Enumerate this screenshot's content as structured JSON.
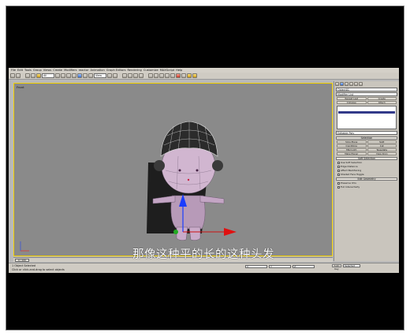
{
  "menu": [
    "File",
    "Edit",
    "Tools",
    "Group",
    "Views",
    "Create",
    "Modifiers",
    "reactor",
    "Animation",
    "Graph Editors",
    "Rendering",
    "Customize",
    "MAXScript",
    "Help"
  ],
  "toolbar": {
    "selection_filter": "All",
    "view_dropdown": "View"
  },
  "viewport": {
    "label": "Front"
  },
  "command_panel": {
    "object_name": "Object01",
    "modifier_list": "Modifier List",
    "stack_item": "Editable Poly",
    "rollout_selection": "Selection",
    "rollout_soft": "Soft Selection",
    "rollout_edit": "Edit Geometry",
    "button_labels": [
      "Repeat Last",
      "Create",
      "Collapse",
      "Attach",
      "Slice Plane",
      "Split",
      "QuickSlice",
      "Cut",
      "MSmooth",
      "Tessellate",
      "Make Planar",
      "View Align"
    ],
    "checks": [
      "Use Soft Selection",
      "Edge Distance",
      "Affect Backfacing",
      "Shaded Face Toggle",
      "Preserve UVs",
      "Full Interactivity"
    ]
  },
  "timeline": {
    "slider_label": "0 / 100"
  },
  "status": {
    "line1": "1 Object Selected",
    "line2": "Click or click-and-drag to select objects",
    "coord_x": "X:",
    "coord_y": "Y:",
    "coord_z": "Z:",
    "auto_key": "Auto Key",
    "key_mode": "Selected"
  },
  "subtitle": "那像这种平的长的这种头发",
  "colors": {
    "viewport_border": "#f2d000",
    "viewport_bg": "#8a8a8a",
    "ui_bg": "#cfcbc3"
  }
}
